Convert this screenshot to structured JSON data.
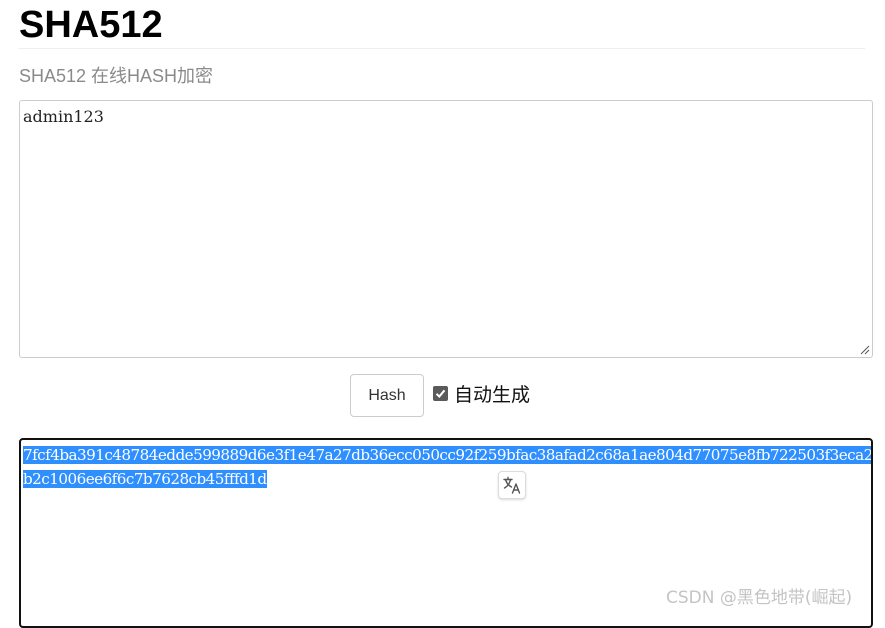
{
  "header": {
    "title": "SHA512",
    "subtitle": "SHA512 在线HASH加密"
  },
  "input": {
    "value": "admin123"
  },
  "controls": {
    "hash_label": "Hash",
    "auto_generate_label": "自动生成",
    "auto_generate_checked": true
  },
  "output": {
    "value": "7fcf4ba391c48784edde599889d6e3f1e47a27db36ecc050cc92f259bfac38afad2c68a1ae804d77075e8fb722503f3eca2b2c1006ee6f6c7b7628cb45fffd1d"
  },
  "overlay": {
    "translate_icon": "translate-icon"
  },
  "watermark": {
    "text": "CSDN @黑色地带(崛起)"
  },
  "colors": {
    "selection": "#2f8fff",
    "subtitle": "#8a8a8a",
    "border": "#cccccc",
    "focus_border": "#111111"
  }
}
